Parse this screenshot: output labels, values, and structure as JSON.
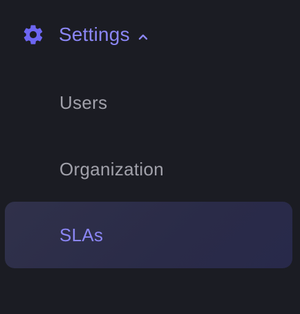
{
  "nav": {
    "section": {
      "label": "Settings",
      "icon": "gear-icon",
      "expanded_icon": "chevron-up-icon",
      "accent": "#8b86f5"
    },
    "items": [
      {
        "label": "Users",
        "active": false
      },
      {
        "label": "Organization",
        "active": false
      },
      {
        "label": "SLAs",
        "active": true
      }
    ]
  },
  "colors": {
    "background": "#1b1c23",
    "inactive_text": "#a1a1aa",
    "active_bg": "#2c2d48"
  }
}
